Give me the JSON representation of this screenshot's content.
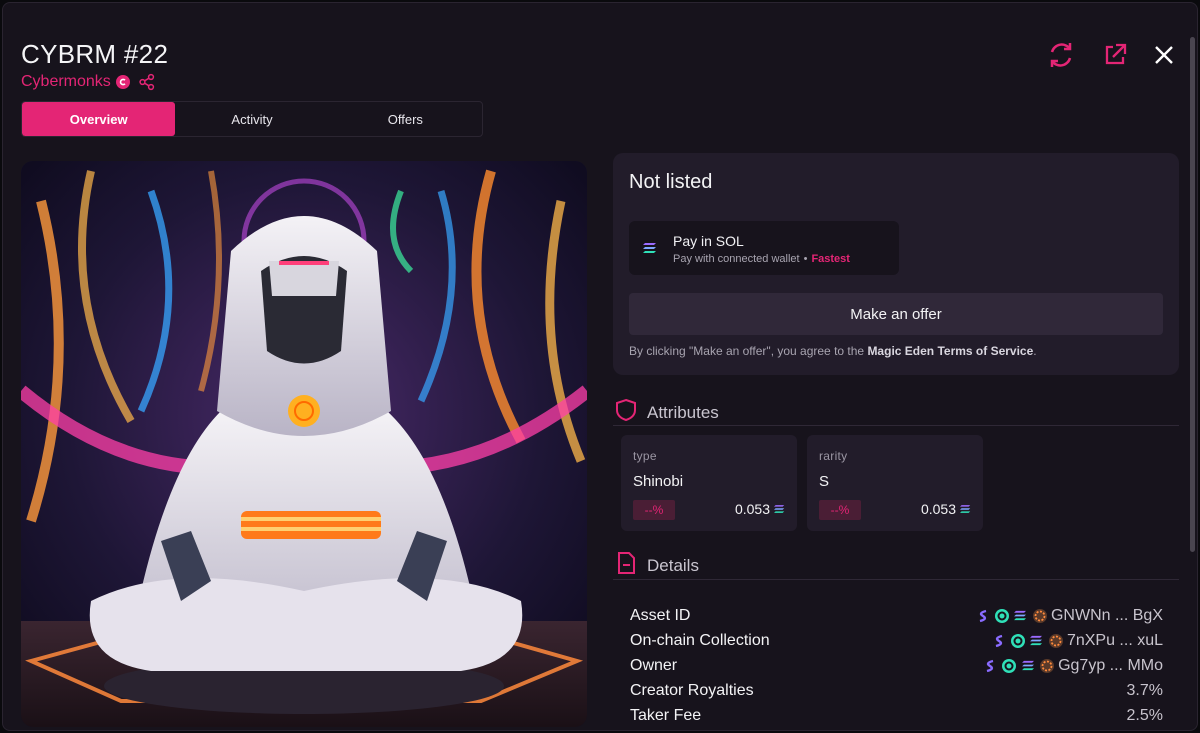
{
  "header": {
    "title": "CYBRM #22",
    "collection": "Cybermonks",
    "actions": [
      "refresh-icon",
      "external-link-icon",
      "close-icon"
    ]
  },
  "tabs": [
    {
      "label": "Overview",
      "active": true
    },
    {
      "label": "Activity",
      "active": false
    },
    {
      "label": "Offers",
      "active": false
    }
  ],
  "buy": {
    "status": "Not listed",
    "pay_title": "Pay in SOL",
    "pay_sub": "Pay with connected wallet",
    "pay_sep": "•",
    "pay_fast": "Fastest",
    "offer_button": "Make an offer",
    "terms_prefix": "By clicking \"Make an offer\", you agree to the ",
    "terms_link": "Magic Eden Terms of Service",
    "terms_suffix": "."
  },
  "attributes": {
    "heading": "Attributes",
    "items": [
      {
        "type": "type",
        "value": "Shinobi",
        "pct": "--%",
        "price": "0.053"
      },
      {
        "type": "rarity",
        "value": "S",
        "pct": "--%",
        "price": "0.053"
      }
    ]
  },
  "details": {
    "heading": "Details",
    "rows": [
      {
        "label": "Asset ID",
        "value": "GNWNn ... BgX",
        "icons": true
      },
      {
        "label": "On-chain Collection",
        "value": "7nXPu ... xuL",
        "icons": true
      },
      {
        "label": "Owner",
        "value": "Gg7yp ... MMo",
        "icons": true
      },
      {
        "label": "Creator Royalties",
        "value": "3.7%",
        "icons": false
      },
      {
        "label": "Taker Fee",
        "value": "2.5%",
        "icons": false
      }
    ]
  },
  "colors": {
    "accent": "#e42575",
    "background": "#17131c",
    "card": "#221c2a"
  }
}
